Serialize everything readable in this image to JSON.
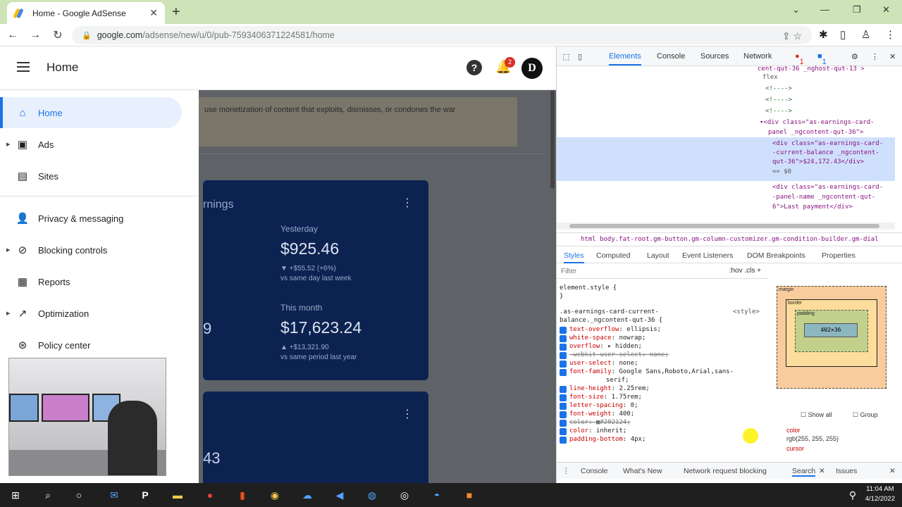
{
  "browser": {
    "tab_title": "Home - Google AdSense",
    "url_host": "google.com",
    "url_path": "/adsense/new/u/0/pub-7593406371224581/home"
  },
  "app": {
    "title": "Home",
    "notification_count": "2",
    "avatar_letter": "D"
  },
  "sidenav": {
    "items": [
      {
        "label": "Home",
        "icon": "home-icon"
      },
      {
        "label": "Ads",
        "icon": "ads-icon"
      },
      {
        "label": "Sites",
        "icon": "sites-icon"
      },
      {
        "label": "Privacy & messaging",
        "icon": "privacy-icon"
      },
      {
        "label": "Blocking controls",
        "icon": "block-icon"
      },
      {
        "label": "Reports",
        "icon": "reports-icon"
      },
      {
        "label": "Optimization",
        "icon": "trend-icon"
      },
      {
        "label": "Policy center",
        "icon": "policy-icon"
      }
    ]
  },
  "content": {
    "banner_text": "use monetization of content that exploits, dismisses, or condones the war",
    "card1": {
      "title_fragment": "rnings",
      "yesterday_label": "Yesterday",
      "yesterday_value": "$925.46",
      "yesterday_change": "▼ +$55.52 (+6%)",
      "yesterday_compare": "vs same day last week",
      "month_label": "This month",
      "month_value": "$17,623.24",
      "month_change": "▲ +$13,321.90",
      "month_compare": "vs same period last year",
      "left_stub": "9"
    },
    "card2": {
      "left_stub": "43"
    }
  },
  "devtools": {
    "tabs": [
      "Elements",
      "Console",
      "Sources",
      "Network"
    ],
    "errors": "1",
    "messages": "1",
    "dom_lines": [
      "cent-qut-36 _nghost-qut-13 >",
      "flex",
      "<!---->",
      "<!---->",
      "<!---->",
      "▾<div class=\"as-earnings-card-",
      "panel _ngcontent-qut-36\">",
      "<div class=\"as-earnings-card-",
      "-current-balance _ngcontent-",
      "qut-36\">$24,172.43</div>",
      "== $0",
      "<div class=\"as-earnings-card-",
      "-panel-name _ngcontent-qut-",
      "6\">Last payment</div>"
    ],
    "breadcrumb": "html   body.fat-root.gm-button.gm-column-customizer.gm-condition-builder.gm-dial",
    "subtabs": [
      "Styles",
      "Computed",
      "Layout",
      "Event Listeners",
      "DOM Breakpoints",
      "Properties"
    ],
    "filter_placeholder": "Filter",
    "filter_tools": ":hov  .cls  +",
    "element_style": "element.style {",
    "element_style_close": "}",
    "selector_line1": ".as-earnings-card-current-",
    "selector_line2": "balance._ngcontent-qut-36 {",
    "selector_source": "<style>",
    "props": [
      {
        "name": "text-overflow",
        "value": "ellipsis;"
      },
      {
        "name": "white-space",
        "value": "nowrap;"
      },
      {
        "name": "overflow",
        "value": "▸ hidden;"
      },
      {
        "name": "-webkit-user-select",
        "value": "none;",
        "struck": true
      },
      {
        "name": "user-select",
        "value": "none;"
      },
      {
        "name": "font-family",
        "value": "Google Sans,Roboto,Arial,sans-"
      },
      {
        "name": "",
        "value": "serif;"
      },
      {
        "name": "line-height",
        "value": "2.25rem;"
      },
      {
        "name": "font-size",
        "value": "1.75rem;"
      },
      {
        "name": "letter-spacing",
        "value": "0;"
      },
      {
        "name": "font-weight",
        "value": "400;"
      },
      {
        "name": "color",
        "value": "■#202124;",
        "struck": true
      },
      {
        "name": "color",
        "value": "inherit;"
      },
      {
        "name": "padding-bottom",
        "value": "4px;"
      }
    ],
    "boxmodel": {
      "margin": "margin",
      "border": "border",
      "padding": "padding",
      "content": "402×36",
      "dash": "-"
    },
    "computed": {
      "show_all": "Show all",
      "group": "Group",
      "prop1_name": "color",
      "prop1_value": "rgb(255, 255, 255)",
      "prop2_name": "cursor"
    },
    "drawer_tabs": [
      "Console",
      "What's New",
      "Network request blocking",
      "Search",
      "Issues"
    ]
  },
  "taskbar": {
    "time": "11:04 AM",
    "date": "4/12/2022"
  }
}
